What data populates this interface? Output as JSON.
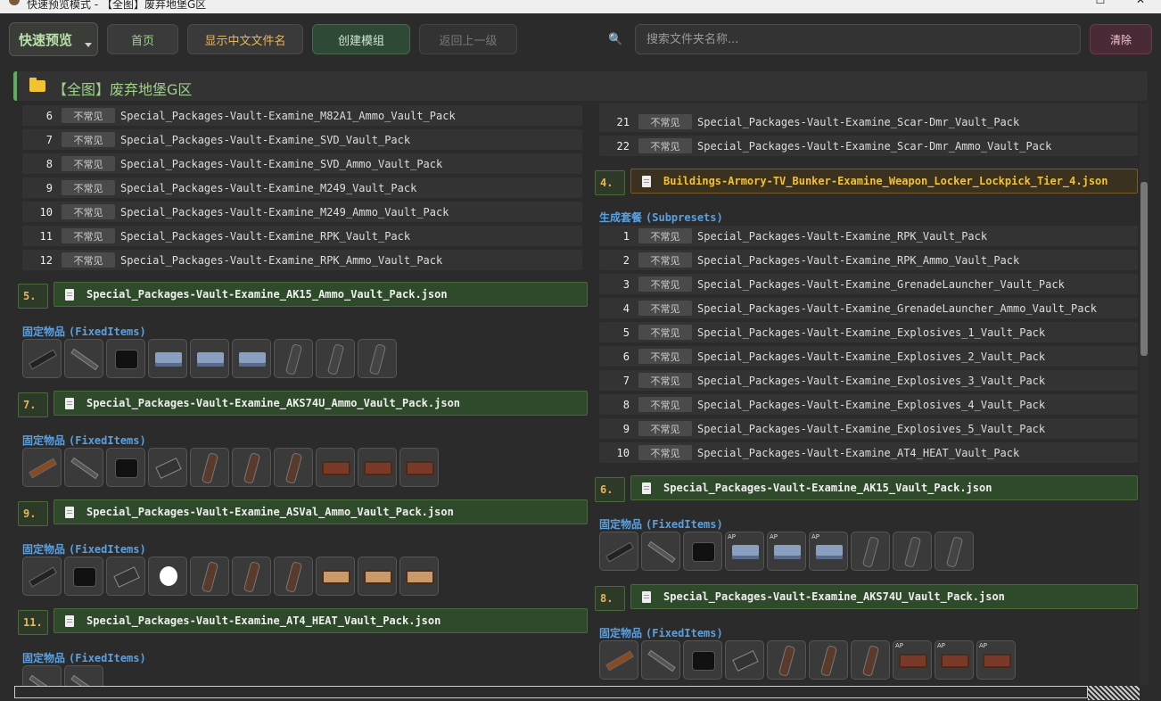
{
  "window": {
    "title": "快速预览模式 - 【全图】废弃地堡G区",
    "minimize": "—",
    "maximize": "☐",
    "close": "✕"
  },
  "toolbar": {
    "mode_select": "快速预览",
    "home_label": "首页",
    "show_cn_label": "显示中文文件名",
    "create_label": "创建模组",
    "back_label": "返回上一级",
    "search_placeholder": "搜索文件夹名称...",
    "clear_label": "清除"
  },
  "breadcrumb": {
    "text": "【全图】废弃地堡G区"
  },
  "labels": {
    "rarity": "不常见",
    "fixed_cn": "固定物品",
    "fixed_en": "(FixedItems)",
    "subpresets_cn": "生成套餐",
    "subpresets_en": "(Subpresets)"
  },
  "left": {
    "rows": [
      {
        "num": "6",
        "name": "Special_Packages-Vault-Examine_M82A1_Ammo_Vault_Pack"
      },
      {
        "num": "7",
        "name": "Special_Packages-Vault-Examine_SVD_Vault_Pack"
      },
      {
        "num": "8",
        "name": "Special_Packages-Vault-Examine_SVD_Ammo_Vault_Pack"
      },
      {
        "num": "9",
        "name": "Special_Packages-Vault-Examine_M249_Vault_Pack"
      },
      {
        "num": "10",
        "name": "Special_Packages-Vault-Examine_M249_Ammo_Vault_Pack"
      },
      {
        "num": "11",
        "name": "Special_Packages-Vault-Examine_RPK_Vault_Pack"
      },
      {
        "num": "12",
        "name": "Special_Packages-Vault-Examine_RPK_Ammo_Vault_Pack"
      }
    ],
    "sections": [
      {
        "num": "5.",
        "file": "Special_Packages-Vault-Examine_AK15_Ammo_Vault_Pack.json"
      },
      {
        "num": "7.",
        "file": "Special_Packages-Vault-Examine_AKS74U_Ammo_Vault_Pack.json"
      },
      {
        "num": "9.",
        "file": "Special_Packages-Vault-Examine_ASVal_Ammo_Vault_Pack.json"
      },
      {
        "num": "11.",
        "file": "Special_Packages-Vault-Examine_AT4_HEAT_Vault_Pack.json"
      }
    ]
  },
  "right": {
    "top_rows": [
      {
        "num": "21",
        "name": "Special_Packages-Vault-Examine_Scar-Dmr_Vault_Pack"
      },
      {
        "num": "22",
        "name": "Special_Packages-Vault-Examine_Scar-Dmr_Ammo_Vault_Pack"
      }
    ],
    "locker_section": {
      "num": "4.",
      "file": "Buildings-Armory-TV_Bunker-Examine_Weapon_Locker_Lockpick_Tier_4.json"
    },
    "subpreset_rows": [
      {
        "num": "1",
        "name": "Special_Packages-Vault-Examine_RPK_Vault_Pack"
      },
      {
        "num": "2",
        "name": "Special_Packages-Vault-Examine_RPK_Ammo_Vault_Pack"
      },
      {
        "num": "3",
        "name": "Special_Packages-Vault-Examine_GrenadeLauncher_Vault_Pack"
      },
      {
        "num": "4",
        "name": "Special_Packages-Vault-Examine_GrenadeLauncher_Ammo_Vault_Pack"
      },
      {
        "num": "5",
        "name": "Special_Packages-Vault-Examine_Explosives_1_Vault_Pack"
      },
      {
        "num": "6",
        "name": "Special_Packages-Vault-Examine_Explosives_2_Vault_Pack"
      },
      {
        "num": "7",
        "name": "Special_Packages-Vault-Examine_Explosives_3_Vault_Pack"
      },
      {
        "num": "8",
        "name": "Special_Packages-Vault-Examine_Explosives_4_Vault_Pack"
      },
      {
        "num": "9",
        "name": "Special_Packages-Vault-Examine_Explosives_5_Vault_Pack"
      },
      {
        "num": "10",
        "name": "Special_Packages-Vault-Examine_AT4_HEAT_Vault_Pack"
      }
    ],
    "sections": [
      {
        "num": "6.",
        "file": "Special_Packages-Vault-Examine_AK15_Vault_Pack.json"
      },
      {
        "num": "8.",
        "file": "Special_Packages-Vault-Examine_AKS74U_Vault_Pack.json"
      }
    ]
  },
  "colors": {
    "accent_green": "#5ab05a",
    "section_orange": "#e8b65a",
    "label_blue": "#5aa0e0",
    "locker_gold": "#f2c230"
  }
}
